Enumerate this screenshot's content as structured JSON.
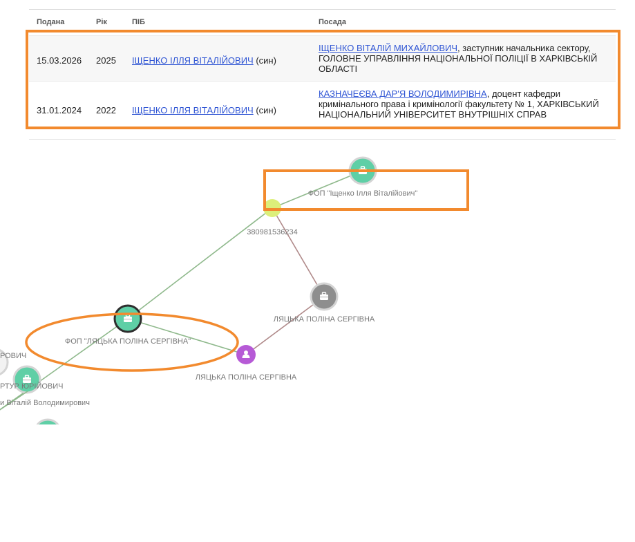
{
  "table": {
    "headers": {
      "submitted": "Подана",
      "year": "Рік",
      "name": "ПІБ",
      "position": "Посада"
    },
    "rows": [
      {
        "submitted": "15.03.2026",
        "year": "2025",
        "name_link": "ІЩЕНКО ІЛЛЯ ВІТАЛІЙОВИЧ",
        "relation": " (син)",
        "position_link": "ІЩЕНКО ВІТАЛІЙ МИХАЙЛОВИЧ",
        "position_text": ", заступник начальника сектору, ГОЛОВНЕ УПРАВЛІННЯ НАЦІОНАЛЬНОЇ ПОЛІЦІЇ В ХАРКІВСЬКІЙ ОБЛАСТІ"
      },
      {
        "submitted": "31.01.2024",
        "year": "2022",
        "name_link": "ІЩЕНКО ІЛЛЯ ВІТАЛІЙОВИЧ",
        "relation": " (син)",
        "position_link": "КАЗНАЧЕЄВА ДАР'Я ВОЛОДИМИРІВНА",
        "position_text": ", доцент кафедри кримінального права і кримінології факультету № 1, ХАРКІВСЬКИЙ НАЦІОНАЛЬНИЙ УНІВЕРСИТЕТ ВНУТРІШНІХ СПРАВ"
      }
    ]
  },
  "graph": {
    "labels": {
      "fop_ishchenko": "ФОП \"Іщенко Ілля Віталійович\"",
      "phone": "380981536234",
      "person_gray": "ЛЯЦЬКА ПОЛІНА СЕРГІВНА",
      "fop_liatska": "ФОП \"ЛЯЦЬКА ПОЛІНА СЕРГІВНА\"",
      "person_purple": "ЛЯЦЬКА ПОЛІНА СЕРГІВНА",
      "partial_1": "РОВИЧ",
      "partial_2": "РТУР ЮРІЙОВИЧ",
      "partial_3": "и Віталій Володимирович"
    },
    "colors": {
      "company_node": "#5fcfa6",
      "phone_node": "#dcef7a",
      "gray_node": "#8e8e8e",
      "person_node": "#b65ad6",
      "edge_green": "#8fb98c",
      "edge_brown": "#b08a8a",
      "annotation": "#f28a2e"
    },
    "icons": {
      "company": "briefcase-icon",
      "person": "person-icon"
    }
  }
}
